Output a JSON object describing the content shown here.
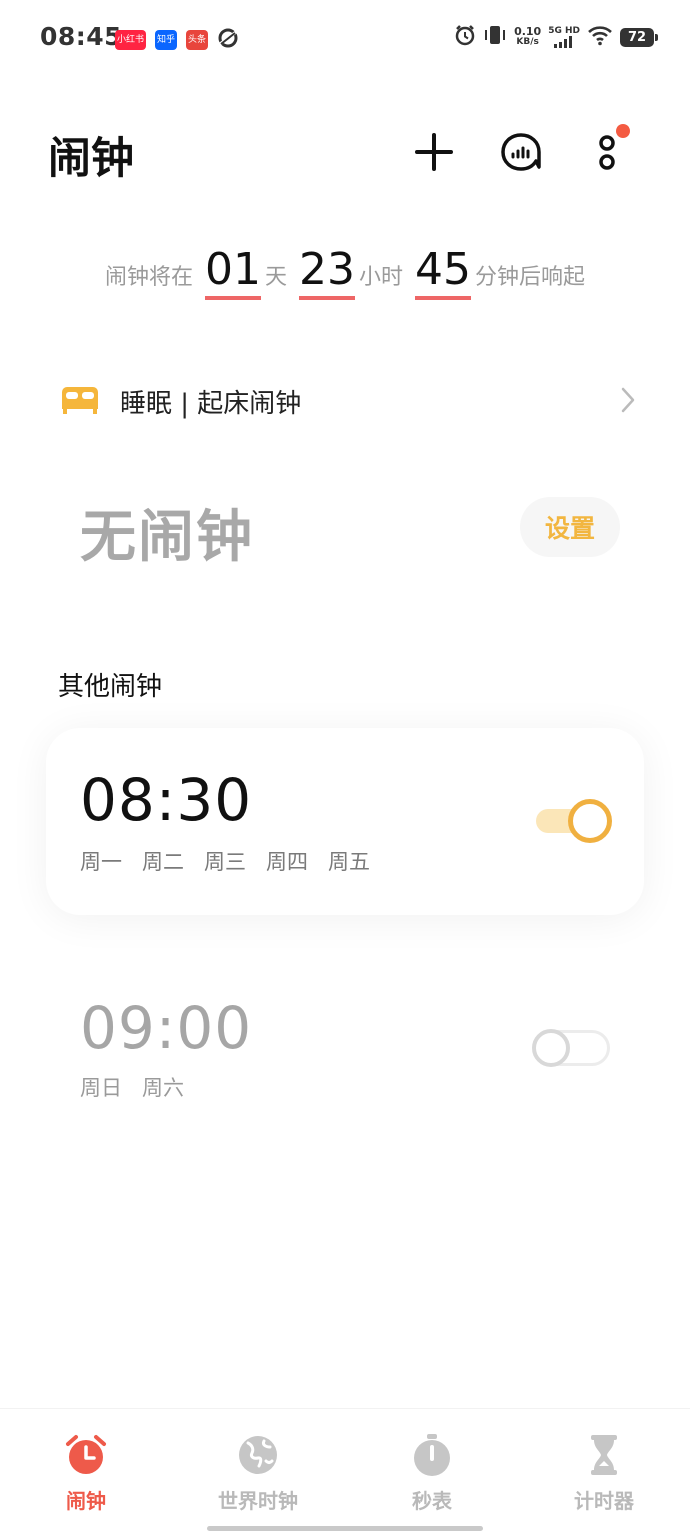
{
  "status_bar": {
    "time": "08:45",
    "apps": [
      {
        "label": "小红书",
        "color": "#ff2442"
      },
      {
        "label": "知乎",
        "color": "#0a66ff"
      },
      {
        "label": "头条",
        "color": "#e8453c"
      }
    ],
    "net_speed_value": "0.10",
    "net_speed_unit": "KB/s",
    "net_type": "5G HD",
    "battery": "72"
  },
  "header": {
    "title": "闹钟",
    "icons": [
      "add-icon",
      "sleep-tracker-icon",
      "more-icon"
    ]
  },
  "countdown": {
    "prefix": "闹钟将在",
    "days": "01",
    "days_unit": "天",
    "hours": "23",
    "hours_unit": "小时",
    "minutes": "45",
    "minutes_unit": "分钟后响起"
  },
  "sleep": {
    "label": "睡眠 | 起床闹钟"
  },
  "no_alarm": {
    "title": "无闹钟",
    "set_label": "设置"
  },
  "other_alarms": {
    "title": "其他闹钟",
    "alarms": [
      {
        "time": "08:30",
        "days": [
          "周一",
          "周二",
          "周三",
          "周四",
          "周五"
        ],
        "enabled": true
      },
      {
        "time": "09:00",
        "days": [
          "周日",
          "周六"
        ],
        "enabled": false
      }
    ]
  },
  "bottom_nav": {
    "items": [
      {
        "label": "闹钟",
        "icon": "alarm-clock-icon",
        "active": true
      },
      {
        "label": "世界时钟",
        "icon": "globe-icon",
        "active": false
      },
      {
        "label": "秒表",
        "icon": "stopwatch-icon",
        "active": false
      },
      {
        "label": "计时器",
        "icon": "hourglass-icon",
        "active": false
      }
    ]
  },
  "colors": {
    "accent": "#f0b040",
    "active_tab": "#ee5a4a",
    "notify_dot": "#f45b42"
  }
}
